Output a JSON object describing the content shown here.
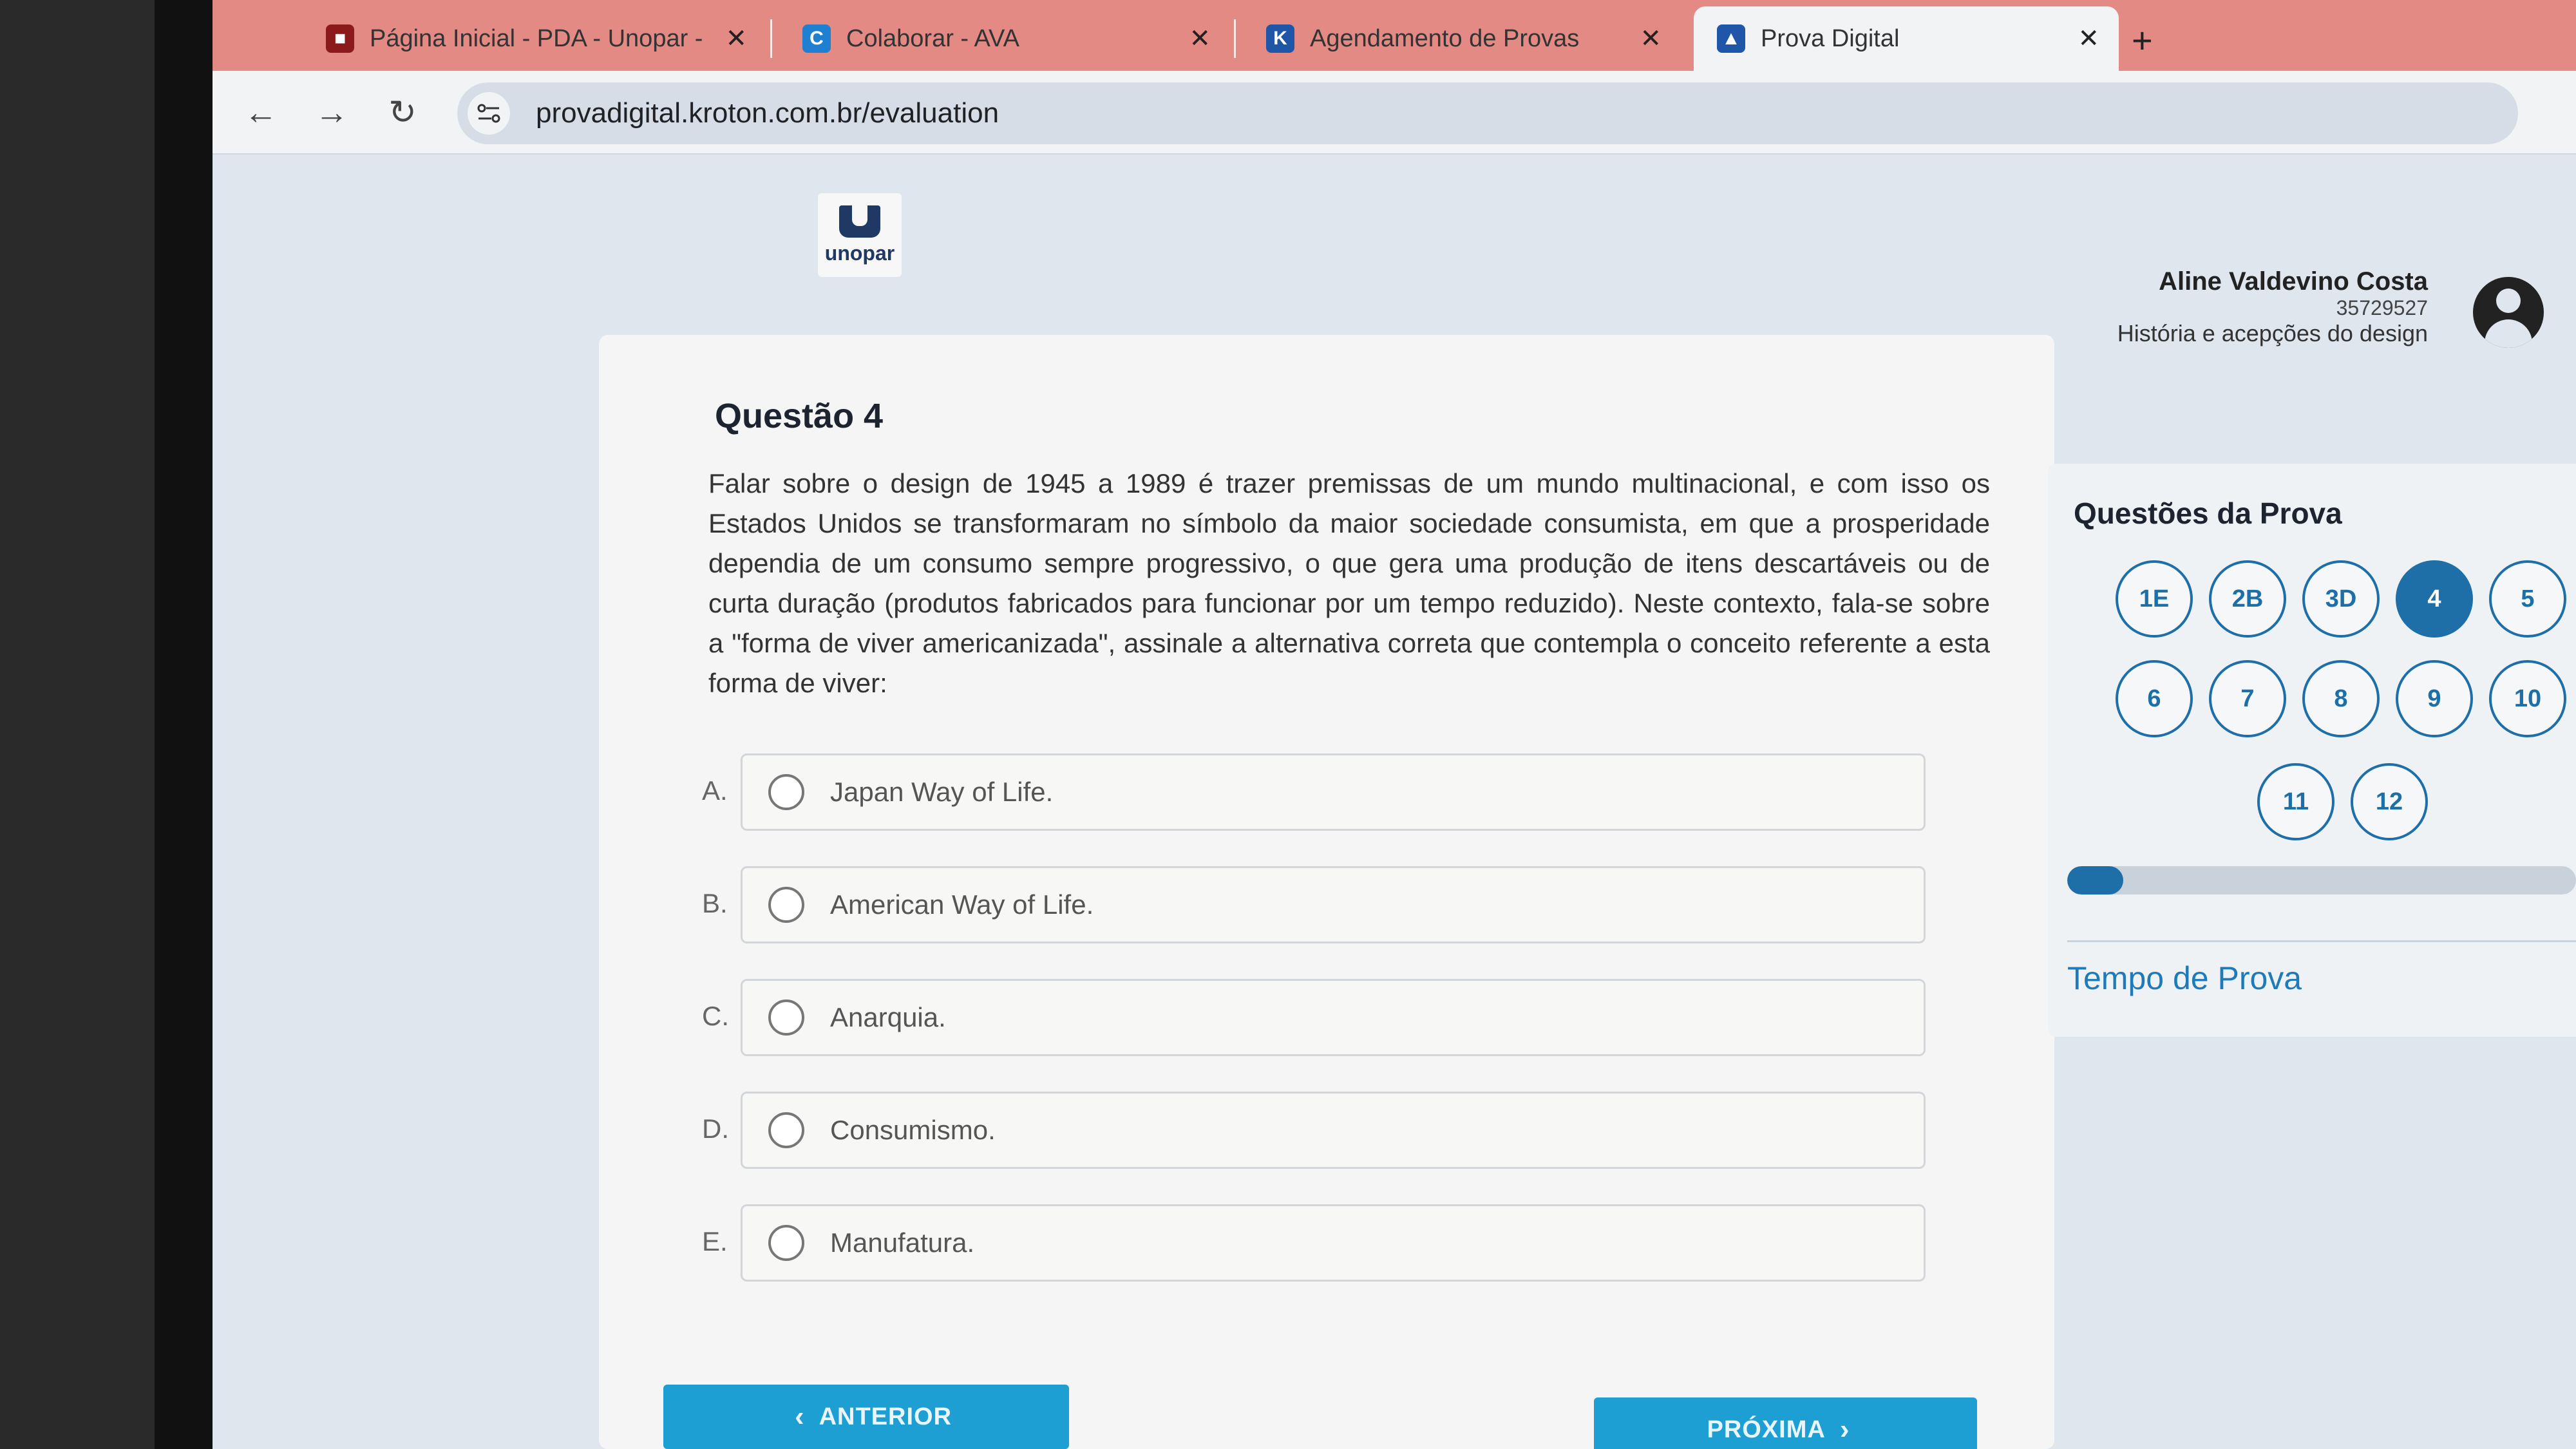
{
  "browser": {
    "tabs": [
      {
        "title": "Página Inicial - PDA - Unopar - ",
        "active": false
      },
      {
        "title": "Colaborar - AVA",
        "active": false
      },
      {
        "title": "Agendamento de Provas",
        "active": false
      },
      {
        "title": "Prova Digital",
        "active": true
      }
    ],
    "close_glyph": "✕",
    "new_tab_glyph": "+",
    "url": "provadigital.kroton.com.br/evaluation",
    "nav": {
      "back": "←",
      "forward": "→",
      "reload": "↻"
    }
  },
  "header": {
    "logo_text": "unopar",
    "user_name": "Aline Valdevino Costa",
    "user_id": "35729527",
    "course": "História e acepções do design"
  },
  "question": {
    "title": "Questão 4",
    "text": "Falar sobre o design de 1945 a 1989 é trazer premissas de um mundo multinacional, e com isso os Estados Unidos se transformaram no símbolo da maior sociedade consumista, em que a prosperidade dependia de um consumo sempre progressivo, o que gera uma produção de itens descartáveis ou de curta duração (produtos fabricados para funcionar por um tempo reduzido). Neste contexto, fala-se sobre a \"forma de viver americanizada\", assinale a alternativa correta que contempla o conceito referente a esta forma de viver:",
    "options": [
      {
        "letter": "A.",
        "text": "Japan Way of Life."
      },
      {
        "letter": "B.",
        "text": "American Way of Life."
      },
      {
        "letter": "C.",
        "text": "Anarquia."
      },
      {
        "letter": "D.",
        "text": "Consumismo."
      },
      {
        "letter": "E.",
        "text": "Manufatura."
      }
    ]
  },
  "navigation": {
    "prev_label": "ANTERIOR",
    "next_label": "PRÓXIMA",
    "prev_icon": "‹",
    "next_icon": "›"
  },
  "sidebar": {
    "title": "Questões da Prova",
    "questions": [
      "1E",
      "2B",
      "3D",
      "4",
      "5",
      "6",
      "7",
      "8",
      "9",
      "10",
      "11",
      "12"
    ],
    "current": "4",
    "progress_fraction": 0.11,
    "timer_label": "Tempo de Prova"
  },
  "colors": {
    "accent": "#1e6fa8",
    "button": "#1e9fd4",
    "tabbar": "#e38a84"
  }
}
